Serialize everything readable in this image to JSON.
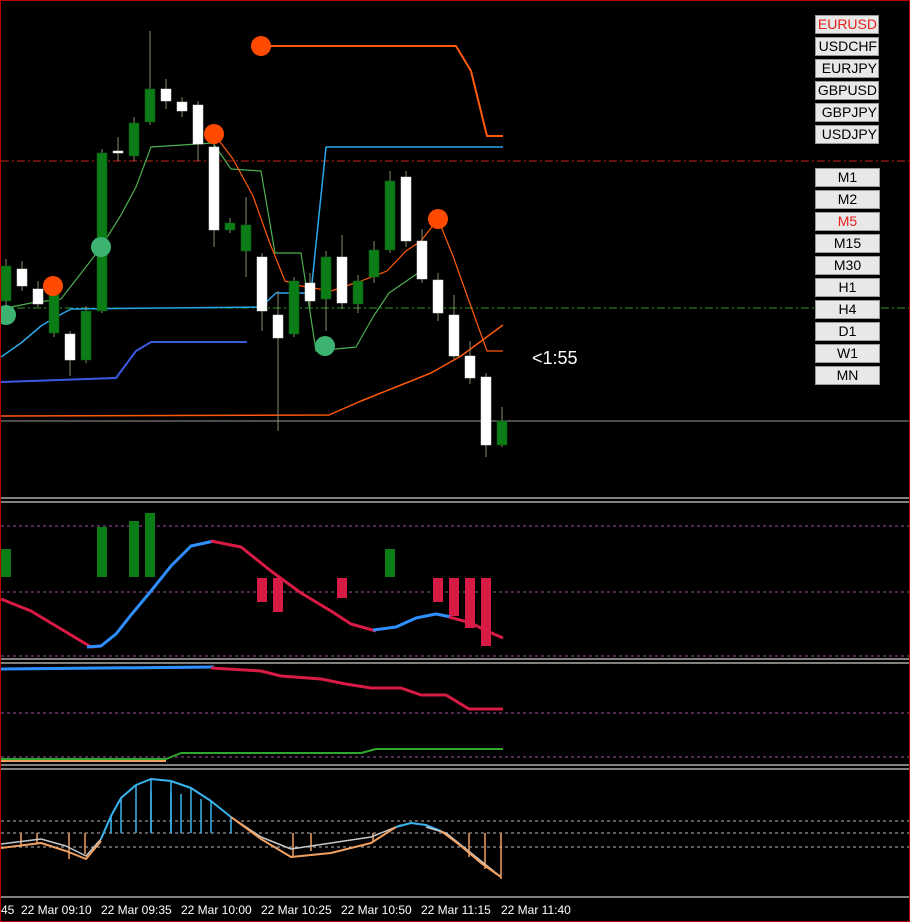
{
  "symbols": [
    {
      "label": "EURUSD",
      "active": true
    },
    {
      "label": "USDCHF",
      "active": false
    },
    {
      "label": "EURJPY",
      "active": false
    },
    {
      "label": "GBPUSD",
      "active": false
    },
    {
      "label": "GBPJPY",
      "active": false
    },
    {
      "label": "USDJPY",
      "active": false
    }
  ],
  "timeframes": [
    {
      "label": "M1",
      "active": false
    },
    {
      "label": "M2",
      "active": false
    },
    {
      "label": "M5",
      "active": true
    },
    {
      "label": "M15",
      "active": false
    },
    {
      "label": "M30",
      "active": false
    },
    {
      "label": "H1",
      "active": false
    },
    {
      "label": "H4",
      "active": false
    },
    {
      "label": "D1",
      "active": false
    },
    {
      "label": "W1",
      "active": false
    },
    {
      "label": "MN",
      "active": false
    }
  ],
  "timer": "<1:55",
  "x_axis": {
    "first_partial": "45",
    "ticks": [
      "22 Mar 09:10",
      "22 Mar 09:35",
      "22 Mar 10:00",
      "22 Mar 10:25",
      "22 Mar 10:50",
      "22 Mar 11:15",
      "22 Mar 11:40"
    ]
  },
  "colors": {
    "bull_candle": "#0a7d16",
    "bear_candle": "#ffffff",
    "wick": "#8a8a6a",
    "orange_line": "#ff5a0a",
    "sky_line": "#2aa8e8",
    "blue_line": "#3a5ae0",
    "green_line": "#4caf50",
    "hist_green": "#0a7d16",
    "hist_red": "#d81b45",
    "osc_blue": "#2e8fff",
    "osc_red": "#d81b45",
    "osc_green": "#2ea82e",
    "lower_blue": "#3ab4f0",
    "lower_orange": "#f0a060",
    "lower_gray": "#c8c8c8"
  },
  "chart_data": {
    "type": "candlestick",
    "timeframe": "M5",
    "symbol": "EURUSD",
    "candles": [
      {
        "o": 300,
        "c": 265,
        "h": 258,
        "l": 312
      },
      {
        "o": 268,
        "c": 285,
        "h": 260,
        "l": 290
      },
      {
        "o": 288,
        "c": 303,
        "h": 280,
        "l": 306
      },
      {
        "o": 332,
        "c": 294,
        "h": 290,
        "l": 336
      },
      {
        "o": 333,
        "c": 359,
        "h": 330,
        "l": 375
      },
      {
        "o": 359,
        "c": 310,
        "h": 305,
        "l": 362
      },
      {
        "o": 310,
        "c": 152,
        "h": 148,
        "l": 312
      },
      {
        "o": 150,
        "c": 150,
        "h": 136,
        "l": 160
      },
      {
        "o": 155,
        "c": 122,
        "h": 116,
        "l": 160
      },
      {
        "o": 121,
        "c": 88,
        "h": 30,
        "l": 124
      },
      {
        "o": 88,
        "c": 100,
        "h": 78,
        "l": 108
      },
      {
        "o": 101,
        "c": 110,
        "h": 96,
        "l": 116
      },
      {
        "o": 104,
        "c": 143,
        "h": 100,
        "l": 160
      },
      {
        "o": 146,
        "c": 229,
        "h": 143,
        "l": 246
      },
      {
        "o": 229,
        "c": 222,
        "h": 217,
        "l": 232
      },
      {
        "o": 250,
        "c": 224,
        "h": 196,
        "l": 276
      },
      {
        "o": 256,
        "c": 310,
        "h": 252,
        "l": 330
      },
      {
        "o": 314,
        "c": 337,
        "h": 290,
        "l": 430
      },
      {
        "o": 333,
        "c": 280,
        "h": 276,
        "l": 336
      },
      {
        "o": 282,
        "c": 300,
        "h": 272,
        "l": 306
      },
      {
        "o": 298,
        "c": 256,
        "h": 250,
        "l": 330
      },
      {
        "o": 256,
        "c": 302,
        "h": 234,
        "l": 308
      },
      {
        "o": 303,
        "c": 280,
        "h": 274,
        "l": 312
      },
      {
        "o": 276,
        "c": 249,
        "h": 240,
        "l": 282
      },
      {
        "o": 249,
        "c": 180,
        "h": 170,
        "l": 252
      },
      {
        "o": 176,
        "c": 240,
        "h": 170,
        "l": 246
      },
      {
        "o": 240,
        "c": 278,
        "h": 228,
        "l": 282
      },
      {
        "o": 279,
        "c": 312,
        "h": 272,
        "l": 320
      },
      {
        "o": 314,
        "c": 355,
        "h": 294,
        "l": 358
      },
      {
        "o": 355,
        "c": 377,
        "h": 340,
        "l": 383
      },
      {
        "o": 376,
        "c": 444,
        "h": 372,
        "l": 456
      },
      {
        "o": 444,
        "c": 420,
        "h": 406,
        "l": 446
      }
    ],
    "upper_orange_line": [
      [
        260,
        45
      ],
      [
        455,
        45
      ],
      [
        470,
        70
      ],
      [
        486,
        135
      ],
      [
        502,
        135
      ]
    ],
    "orange_dots": [
      [
        260,
        45
      ],
      [
        213,
        133
      ],
      [
        437,
        218
      ],
      [
        52,
        285
      ]
    ],
    "sky_stepline": [
      [
        0,
        356
      ],
      [
        20,
        342
      ],
      [
        40,
        325
      ],
      [
        55,
        316
      ],
      [
        70,
        308
      ],
      [
        260,
        306
      ],
      [
        275,
        292
      ],
      [
        310,
        292
      ],
      [
        325,
        146
      ],
      [
        502,
        146
      ]
    ],
    "blue_stepline": [
      [
        0,
        381
      ],
      [
        115,
        377
      ],
      [
        135,
        350
      ],
      [
        150,
        341
      ],
      [
        246,
        341
      ]
    ],
    "green_line": [
      [
        0,
        308
      ],
      [
        30,
        302
      ],
      [
        60,
        298
      ],
      [
        88,
        262
      ],
      [
        100,
        246
      ],
      [
        120,
        214
      ],
      [
        135,
        186
      ],
      [
        150,
        146
      ],
      [
        212,
        142
      ],
      [
        230,
        168
      ],
      [
        260,
        170
      ],
      [
        274,
        252
      ],
      [
        300,
        252
      ],
      [
        315,
        350
      ],
      [
        355,
        346
      ],
      [
        372,
        316
      ],
      [
        388,
        292
      ],
      [
        420,
        270
      ],
      [
        425,
        240
      ]
    ],
    "green_dots": [
      [
        100,
        246
      ],
      [
        324,
        345
      ],
      [
        5,
        314
      ]
    ],
    "orange_descent": [
      [
        213,
        133
      ],
      [
        232,
        158
      ],
      [
        252,
        195
      ],
      [
        268,
        240
      ],
      [
        284,
        280
      ],
      [
        300,
        285
      ],
      [
        330,
        290
      ],
      [
        360,
        280
      ],
      [
        386,
        270
      ],
      [
        405,
        250
      ],
      [
        420,
        240
      ],
      [
        437,
        218
      ],
      [
        452,
        255
      ],
      [
        468,
        300
      ],
      [
        486,
        350
      ],
      [
        502,
        350
      ]
    ],
    "orange_baseline": [
      [
        0,
        415
      ],
      [
        328,
        414
      ],
      [
        360,
        400
      ],
      [
        400,
        384
      ],
      [
        430,
        372
      ],
      [
        460,
        355
      ],
      [
        502,
        324
      ]
    ]
  }
}
